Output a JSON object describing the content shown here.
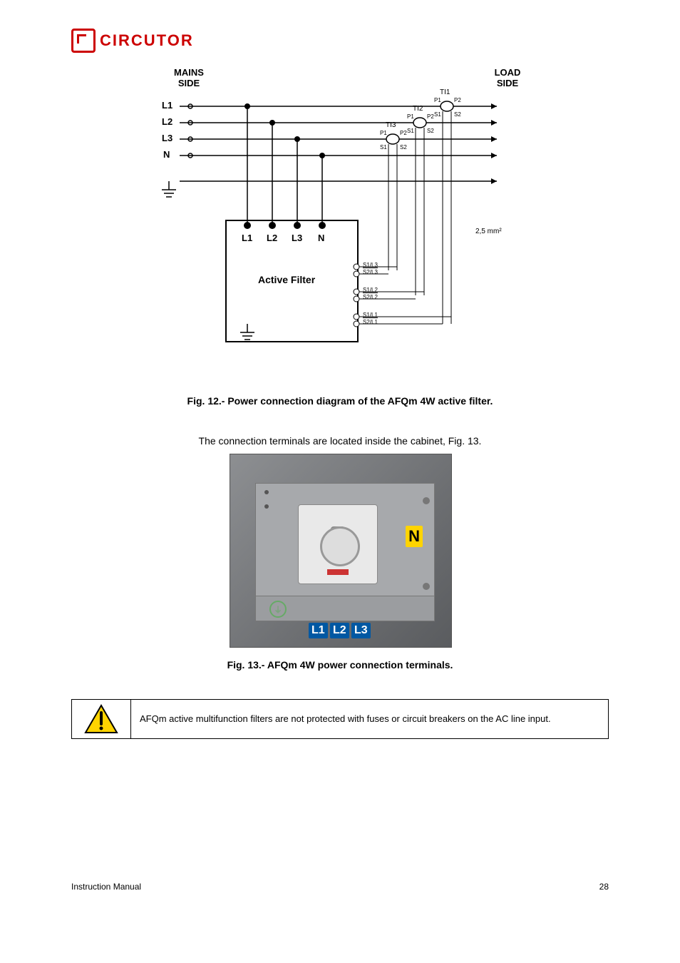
{
  "brand": {
    "name": "CIRCUTOR"
  },
  "diagram": {
    "mains_side": "MAINS SIDE",
    "load_side": "LOAD SIDE",
    "lines": {
      "l1": "L1",
      "l2": "L2",
      "l3": "L3",
      "n": "N"
    },
    "ct": {
      "ti1": "TI1",
      "ti2": "TI2",
      "ti3": "TI3",
      "p1": "P1",
      "p2": "P2",
      "s1": "S1",
      "s2": "S2"
    },
    "filter_label": "Active Filter",
    "filter_terminals": {
      "l1": "L1",
      "l2": "L2",
      "l3": "L3",
      "n": "N"
    },
    "ct_terminals": {
      "a1": "S1/L3",
      "a2": "S2/L3",
      "b1": "S1/L2",
      "b2": "S2/L2",
      "c1": "S1/L1",
      "c2": "S2/L1"
    },
    "wire_note": "2,5 mm²"
  },
  "captions": {
    "fig12": "Fig. 12.- Power connection diagram of the AFQm 4W active filter.",
    "subheading": "The connection terminals are located inside the cabinet, Fig. 13.",
    "fig13": "Fig. 13.- AFQm 4W power connection terminals."
  },
  "photo_labels": {
    "n": "N",
    "l1": "L1",
    "l2": "L2",
    "l3": "L3"
  },
  "warning": {
    "text": "AFQm active multifunction filters are not protected with fuses or circuit breakers on the AC line input."
  },
  "footer": {
    "page_label": "Instruction Manual",
    "page_num": "28"
  }
}
